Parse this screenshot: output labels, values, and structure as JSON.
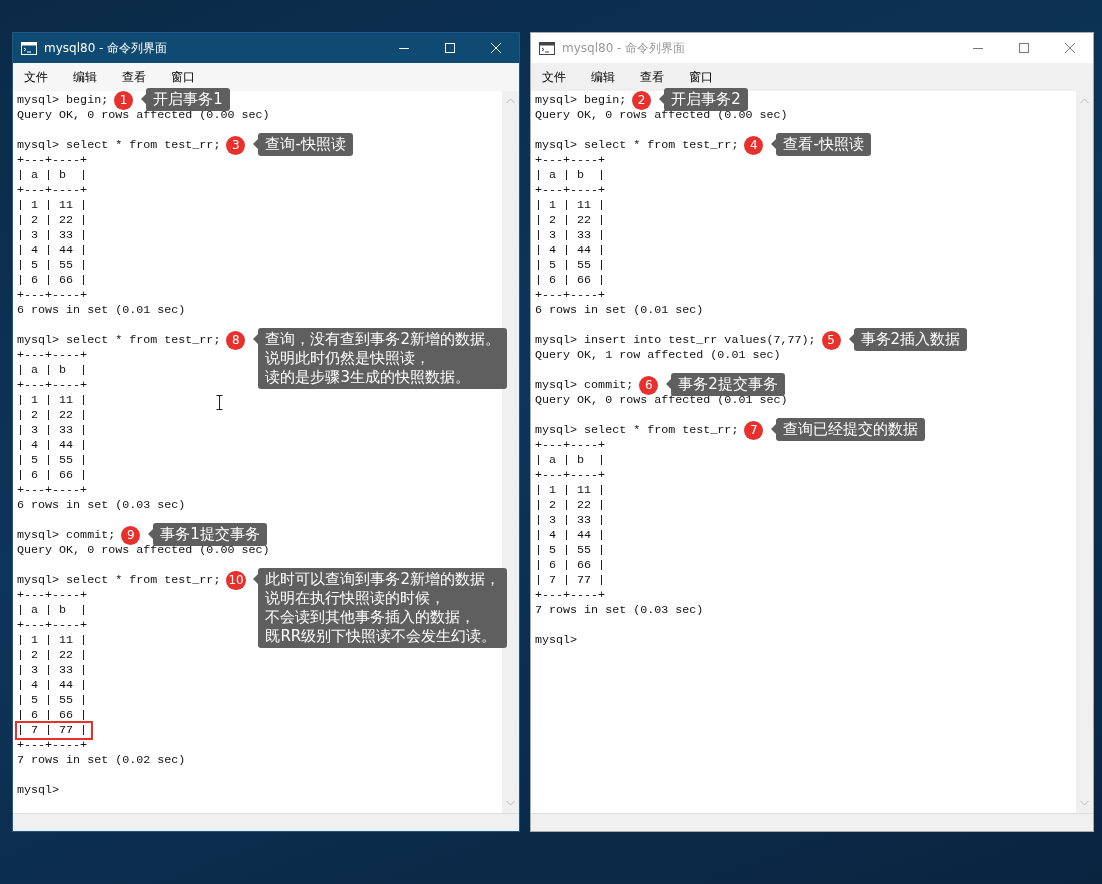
{
  "windows": [
    {
      "title": "mysql80 - 命令列界面",
      "active": true,
      "menu": [
        "文件",
        "编辑",
        "查看",
        "窗口"
      ],
      "lines": [
        {
          "text": "mysql> begin;",
          "boxed": false,
          "note": {
            "badge": "1",
            "lines": [
              "开启事务1"
            ]
          }
        },
        {
          "text": "Query OK, 0 rows affected (0.00 sec)",
          "boxed": false
        },
        {
          "boxed": false
        },
        {
          "text": "mysql> select * from test_rr;",
          "boxed": false,
          "note": {
            "badge": "3",
            "lines": [
              "查询-快照读"
            ]
          }
        },
        {
          "text": "+---+----+",
          "boxed": false
        },
        {
          "text": "| a | b  |",
          "boxed": false
        },
        {
          "text": "+---+----+",
          "boxed": false
        },
        {
          "text": "| 1 | 11 |",
          "boxed": false
        },
        {
          "text": "| 2 | 22 |",
          "boxed": false
        },
        {
          "text": "| 3 | 33 |",
          "boxed": false
        },
        {
          "text": "| 4 | 44 |",
          "boxed": false
        },
        {
          "text": "| 5 | 55 |",
          "boxed": false
        },
        {
          "text": "| 6 | 66 |",
          "boxed": false
        },
        {
          "text": "+---+----+",
          "boxed": false
        },
        {
          "text": "6 rows in set (0.01 sec)",
          "boxed": false
        },
        {
          "boxed": false
        },
        {
          "text": "mysql> select * from test_rr;",
          "boxed": false,
          "note": {
            "badge": "8",
            "lines": [
              "查询，没有查到事务2新增的数据。",
              "说明此时仍然是快照读，",
              "读的是步骤3生成的快照数据。"
            ]
          }
        },
        {
          "text": "+---+----+",
          "boxed": false
        },
        {
          "text": "| a | b  |",
          "boxed": false
        },
        {
          "text": "+---+----+",
          "boxed": false
        },
        {
          "text": "| 1 | 11 |",
          "boxed": false
        },
        {
          "text": "| 2 | 22 |",
          "boxed": false
        },
        {
          "text": "| 3 | 33 |",
          "boxed": false
        },
        {
          "text": "| 4 | 44 |",
          "boxed": false
        },
        {
          "text": "| 5 | 55 |",
          "boxed": false
        },
        {
          "text": "| 6 | 66 |",
          "boxed": false
        },
        {
          "text": "+---+----+",
          "boxed": false
        },
        {
          "text": "6 rows in set (0.03 sec)",
          "boxed": false
        },
        {
          "boxed": false
        },
        {
          "text": "mysql> commit;",
          "boxed": false,
          "note": {
            "badge": "9",
            "lines": [
              "事务1提交事务"
            ]
          }
        },
        {
          "text": "Query OK, 0 rows affected (0.00 sec)",
          "boxed": false
        },
        {
          "boxed": false
        },
        {
          "text": "mysql> select * from test_rr;",
          "boxed": false,
          "note": {
            "badge": "10",
            "lines": [
              "此时可以查询到事务2新增的数据，",
              "说明在执行快照读的时候，",
              "不会读到其他事务插入的数据，",
              "既RR级别下快照读不会发生幻读。"
            ]
          }
        },
        {
          "text": "+---+----+",
          "boxed": false
        },
        {
          "text": "| a | b  |",
          "boxed": false
        },
        {
          "text": "+---+----+",
          "boxed": false
        },
        {
          "text": "| 1 | 11 |",
          "boxed": false
        },
        {
          "text": "| 2 | 22 |",
          "boxed": false
        },
        {
          "text": "| 3 | 33 |",
          "boxed": false
        },
        {
          "text": "| 4 | 44 |",
          "boxed": false
        },
        {
          "text": "| 5 | 55 |",
          "boxed": false
        },
        {
          "text": "| 6 | 66 |",
          "boxed": false
        },
        {
          "text": "| 7 | 77 |",
          "boxed": true
        },
        {
          "text": "+---+----+",
          "boxed": false
        },
        {
          "text": "7 rows in set (0.02 sec)",
          "boxed": false
        },
        {
          "boxed": false
        },
        {
          "text": "mysql>",
          "boxed": false
        }
      ]
    },
    {
      "title": "mysql80 - 命令列界面",
      "active": false,
      "menu": [
        "文件",
        "编辑",
        "查看",
        "窗口"
      ],
      "lines": [
        {
          "text": "mysql> begin;",
          "boxed": false,
          "note": {
            "badge": "2",
            "lines": [
              "开启事务2"
            ]
          }
        },
        {
          "text": "Query OK, 0 rows affected (0.00 sec)",
          "boxed": false
        },
        {
          "boxed": false
        },
        {
          "text": "mysql> select * from test_rr;",
          "boxed": false,
          "note": {
            "badge": "4",
            "lines": [
              "查看-快照读"
            ]
          }
        },
        {
          "text": "+---+----+",
          "boxed": false
        },
        {
          "text": "| a | b  |",
          "boxed": false
        },
        {
          "text": "+---+----+",
          "boxed": false
        },
        {
          "text": "| 1 | 11 |",
          "boxed": false
        },
        {
          "text": "| 2 | 22 |",
          "boxed": false
        },
        {
          "text": "| 3 | 33 |",
          "boxed": false
        },
        {
          "text": "| 4 | 44 |",
          "boxed": false
        },
        {
          "text": "| 5 | 55 |",
          "boxed": false
        },
        {
          "text": "| 6 | 66 |",
          "boxed": false
        },
        {
          "text": "+---+----+",
          "boxed": false
        },
        {
          "text": "6 rows in set (0.01 sec)",
          "boxed": false
        },
        {
          "boxed": false
        },
        {
          "text": "mysql> insert into test_rr values(7,77);",
          "boxed": false,
          "note": {
            "badge": "5",
            "lines": [
              "事务2插入数据"
            ]
          }
        },
        {
          "text": "Query OK, 1 row affected (0.01 sec)",
          "boxed": false
        },
        {
          "boxed": false
        },
        {
          "text": "mysql> commit;",
          "boxed": false,
          "note": {
            "badge": "6",
            "lines": [
              "事务2提交事务"
            ]
          }
        },
        {
          "text": "Query OK, 0 rows affected (0.01 sec)",
          "boxed": false
        },
        {
          "boxed": false
        },
        {
          "text": "mysql> select * from test_rr;",
          "boxed": false,
          "note": {
            "badge": "7",
            "lines": [
              "查询已经提交的数据"
            ]
          }
        },
        {
          "text": "+---+----+",
          "boxed": false
        },
        {
          "text": "| a | b  |",
          "boxed": false
        },
        {
          "text": "+---+----+",
          "boxed": false
        },
        {
          "text": "| 1 | 11 |",
          "boxed": false
        },
        {
          "text": "| 2 | 22 |",
          "boxed": false
        },
        {
          "text": "| 3 | 33 |",
          "boxed": false
        },
        {
          "text": "| 4 | 44 |",
          "boxed": false
        },
        {
          "text": "| 5 | 55 |",
          "boxed": false
        },
        {
          "text": "| 6 | 66 |",
          "boxed": false
        },
        {
          "text": "| 7 | 77 |",
          "boxed": false
        },
        {
          "text": "+---+----+",
          "boxed": false
        },
        {
          "text": "7 rows in set (0.03 sec)",
          "boxed": false
        },
        {
          "boxed": false
        },
        {
          "text": "mysql>",
          "boxed": false
        }
      ]
    }
  ]
}
